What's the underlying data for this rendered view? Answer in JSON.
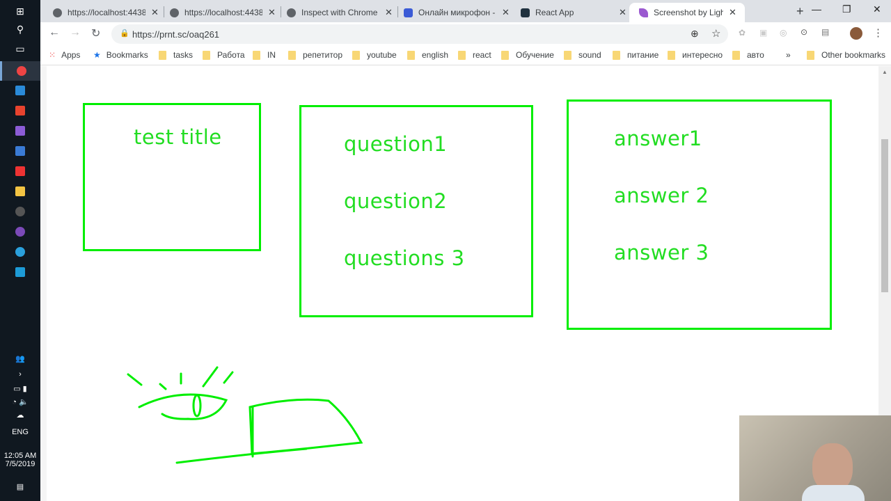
{
  "taskbar": {
    "tray": {
      "language": "ENG",
      "time": "12:05 AM",
      "date": "7/5/2019"
    }
  },
  "tabs": [
    {
      "title": "https://localhost:4438",
      "icon": "globe-icon"
    },
    {
      "title": "https://localhost:4438",
      "icon": "globe-icon"
    },
    {
      "title": "Inspect with Chrome Developer Tools",
      "icon": "globe-icon"
    },
    {
      "title": "Онлайн микрофон - ",
      "icon": "microphone-icon"
    },
    {
      "title": "React App",
      "icon": "react-icon"
    },
    {
      "title": "Screenshot by Lightshot",
      "icon": "lightshot-feather-icon",
      "active": true
    }
  ],
  "toolbar": {
    "url": "https://prnt.sc/oaq261"
  },
  "bookmarks": {
    "items": [
      "Apps",
      "Bookmarks",
      "tasks",
      "Работа",
      "IN",
      "репетитор",
      "youtube",
      "english",
      "react",
      "Обучение",
      "sound",
      "питание",
      "интересно",
      "авто"
    ],
    "overflow": "»",
    "other": "Other bookmarks"
  },
  "drawing": {
    "title_box": "test title",
    "questions": [
      "question1",
      "question2",
      "questions 3"
    ],
    "answers": [
      "answer1",
      "answer 2",
      "answer 3"
    ],
    "stroke_color": "#00ee00"
  }
}
